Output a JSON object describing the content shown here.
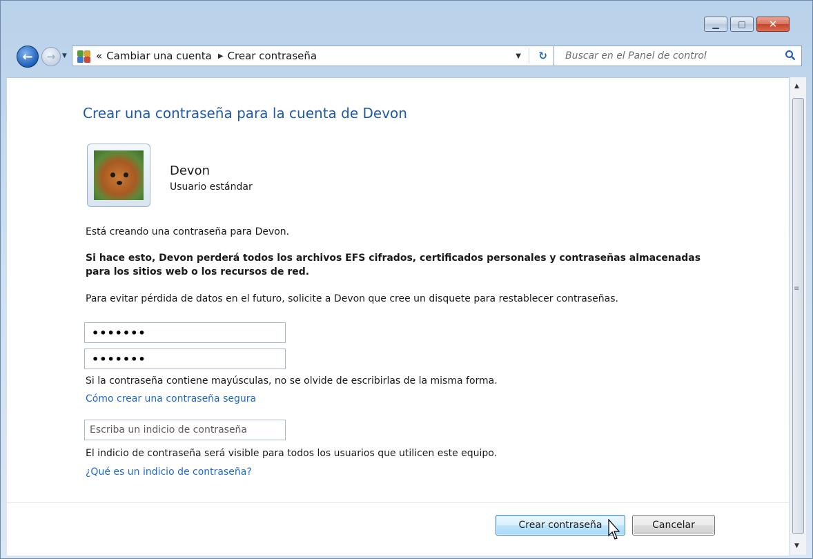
{
  "window": {
    "caption_buttons": {
      "minimize": "minimize-icon",
      "maximize": "maximize-icon",
      "close": "close-icon"
    }
  },
  "nav": {
    "breadcrumb_prefix": "«",
    "breadcrumbs": [
      "Cambiar una cuenta",
      "Crear contraseña"
    ],
    "search_placeholder": "Buscar en el Panel de control",
    "icons": [
      "back-arrow-icon",
      "forward-arrow-icon",
      "user-accounts-icon",
      "refresh-icon",
      "search-icon"
    ]
  },
  "main": {
    "title": "Crear una contraseña para la cuenta de Devon",
    "user": {
      "name": "Devon",
      "role": "Usuario estándar"
    },
    "intro": "Está creando una contraseña para Devon.",
    "warning": "Si hace esto, Devon perderá todos los archivos EFS cifrados, certificados personales y contraseñas almacenadas para los sitios web o los recursos de red.",
    "advice": "Para evitar pérdida de datos en el futuro, solicite a Devon que cree un disquete para restablecer contraseñas.",
    "password_value": "•••••••",
    "confirm_value": "•••••••",
    "caps_note": "Si la contraseña contiene mayúsculas, no se olvide de escribirlas de la misma forma.",
    "strong_link": "Cómo crear una contraseña segura",
    "hint_placeholder": "Escriba un indicio de contraseña",
    "hint_note": "El indicio de contraseña será visible para todos los usuarios que utilicen este equipo.",
    "hint_link": "¿Qué es un indicio de contraseña?"
  },
  "footer": {
    "create_label": "Crear contraseña",
    "cancel_label": "Cancelar"
  },
  "colors": {
    "link": "#1e6ac8",
    "title": "#1e5aa8",
    "accent": "#3c7fb1"
  }
}
